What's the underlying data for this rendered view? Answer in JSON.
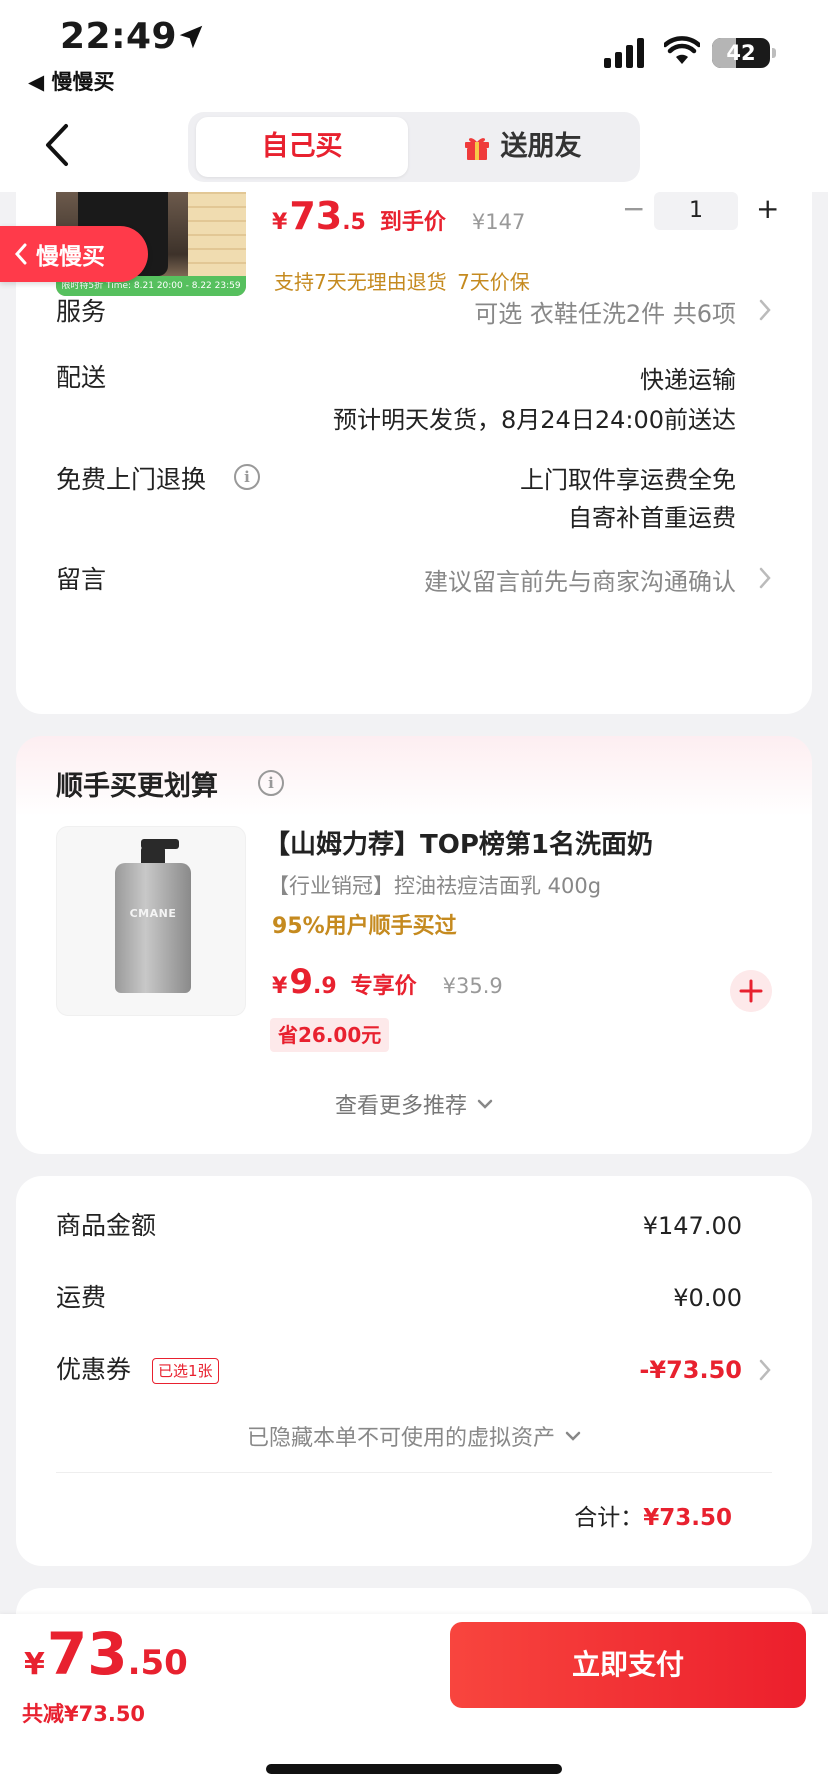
{
  "status_bar": {
    "time": "22:49",
    "back_app": "◀ 慢慢买",
    "battery": "42",
    "battery_level": 0.42
  },
  "nav": {
    "tab_self": "自己买",
    "tab_gift": "送朋友"
  },
  "product": {
    "thumb_band": "限时特5折  Time: 8.21 20:00 - 8.22 23:59",
    "slow_tag": "慢慢买",
    "price_currency": "¥",
    "price_int": "73",
    "price_dec": ".5",
    "price_tag": "到手价",
    "orig_price": "¥147",
    "qty_minus": "−",
    "quantity": "1",
    "qty_plus": "+",
    "guarantee": "支持7天无理由退货  7天价保"
  },
  "rows": {
    "service_label": "服务",
    "service_value": "可选 衣鞋任洗2件 共6项",
    "delivery_label": "配送",
    "delivery_value1": "快递运输",
    "delivery_value2": "预计明天发货，8月24日24:00前送达",
    "return_label": "免费上门退换",
    "return_value1": "上门取件享运费全免",
    "return_value2": "自寄补首重运费",
    "message_label": "留言",
    "message_placeholder": "建议留言前先与商家沟通确认"
  },
  "addon": {
    "title": "顺手买更划算",
    "brand_on_bottle": "CMANE",
    "product_title": "【山姆力荐】TOP榜第1名洗面奶",
    "product_sub": "【行业销冠】控油祛痘洁面乳 400g",
    "product_hot": "95%用户顺手买过",
    "price_currency": "¥",
    "price_int": "9",
    "price_dec": ".9",
    "price_tag": "专享价",
    "orig_price": "¥35.9",
    "save": "省26.00元",
    "more": "查看更多推荐"
  },
  "summary": {
    "goods_label": "商品金额",
    "goods_value": "¥147.00",
    "shipping_label": "运费",
    "shipping_value": "¥0.00",
    "coupon_label": "优惠券",
    "coupon_badge": "已选1张",
    "coupon_value": "-¥73.50",
    "hidden_assets": "已隐藏本单不可使用的虚拟资产",
    "total_label": "合计：",
    "total_value": "¥73.50"
  },
  "footer": {
    "currency": "¥",
    "price_int": "73",
    "price_dec": ".50",
    "saved": "共减¥73.50",
    "pay_button": "立即支付"
  },
  "colors": {
    "accent_red": "#e8212f",
    "gold_text": "#c58a1f",
    "gray_text": "#888888",
    "page_bg": "#f2f2f4"
  },
  "icons": [
    "location-arrow-icon",
    "cellular-signal-icon",
    "wifi-icon",
    "battery-icon",
    "back-chevron-icon",
    "gift-icon",
    "chevron-right-icon",
    "info-icon",
    "chevron-down-icon",
    "plus-circle-icon"
  ]
}
